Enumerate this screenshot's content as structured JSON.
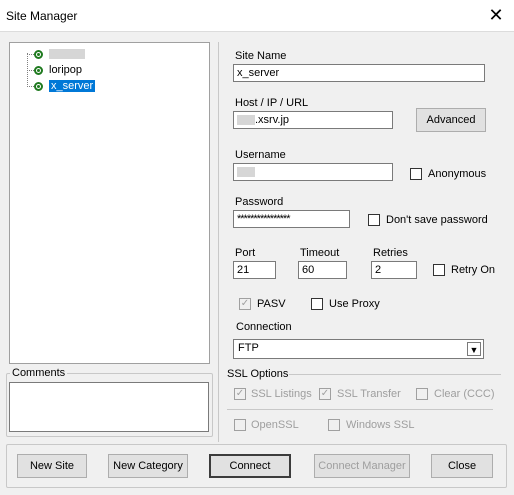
{
  "window": {
    "title": "Site Manager"
  },
  "tree": {
    "items": [
      {
        "label": ""
      },
      {
        "label": "loripop"
      },
      {
        "label": "x_server"
      }
    ]
  },
  "comments": {
    "label": "Comments",
    "value": ""
  },
  "form": {
    "site_name_label": "Site Name",
    "site_name_value": "x_server",
    "host_label": "Host / IP / URL",
    "host_value": ".xsrv.jp",
    "advanced_label": "Advanced",
    "username_label": "Username",
    "username_value": "",
    "anonymous_label": "Anonymous",
    "password_label": "Password",
    "password_value": "****************",
    "dont_save_label": "Don't save password",
    "port_label": "Port",
    "port_value": "21",
    "timeout_label": "Timeout",
    "timeout_value": "60",
    "retries_label": "Retries",
    "retries_value": "2",
    "retry_on_label": "Retry On",
    "pasv_label": "PASV",
    "pasv_checked": true,
    "use_proxy_label": "Use Proxy",
    "connection_label": "Connection",
    "connection_value": "FTP"
  },
  "ssl": {
    "title": "SSL Options",
    "ssl_listings": "SSL Listings",
    "ssl_transfer": "SSL Transfer",
    "clear_ccc": "Clear (CCC)",
    "openssl": "OpenSSL",
    "windows_ssl": "Windows SSL"
  },
  "buttons": {
    "new_site": "New Site",
    "new_category": "New Category",
    "connect": "Connect",
    "connect_manager": "Connect Manager",
    "close": "Close"
  }
}
